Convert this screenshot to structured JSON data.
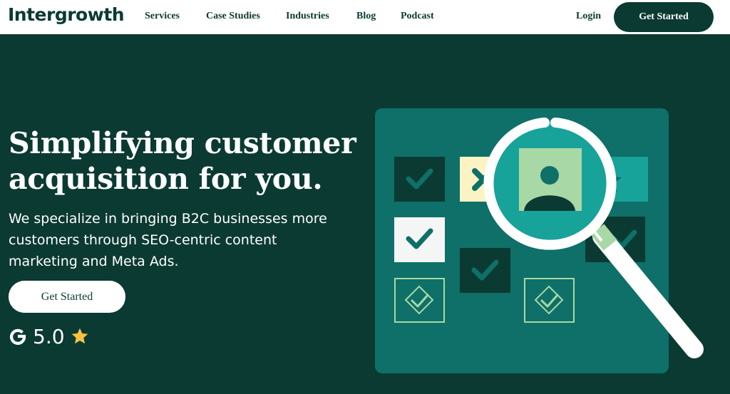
{
  "header": {
    "logo": "Intergrowth",
    "nav": [
      {
        "label": "Services"
      },
      {
        "label": "Case Studies"
      },
      {
        "label": "Industries"
      },
      {
        "label": "Blog"
      },
      {
        "label": "Podcast"
      }
    ],
    "login_label": "Login",
    "cta_label": "Get Started"
  },
  "hero": {
    "headline_line1": "Simplifying customer",
    "headline_line2": "acquisition for you.",
    "subtext": "We specialize in bringing B2C businesses more customers through SEO-centric content marketing and Meta Ads.",
    "cta_label": "Get Started",
    "rating": {
      "value": "5.0",
      "source_icon": "google-g-icon",
      "star_icon": "star-icon"
    }
  },
  "colors": {
    "brand_dark": "#0b3a32",
    "illustration_bg": "#0e7068",
    "accent_light_green": "#a8d8a5",
    "accent_cream": "#fbf3c4",
    "star_yellow": "#f6c341"
  }
}
